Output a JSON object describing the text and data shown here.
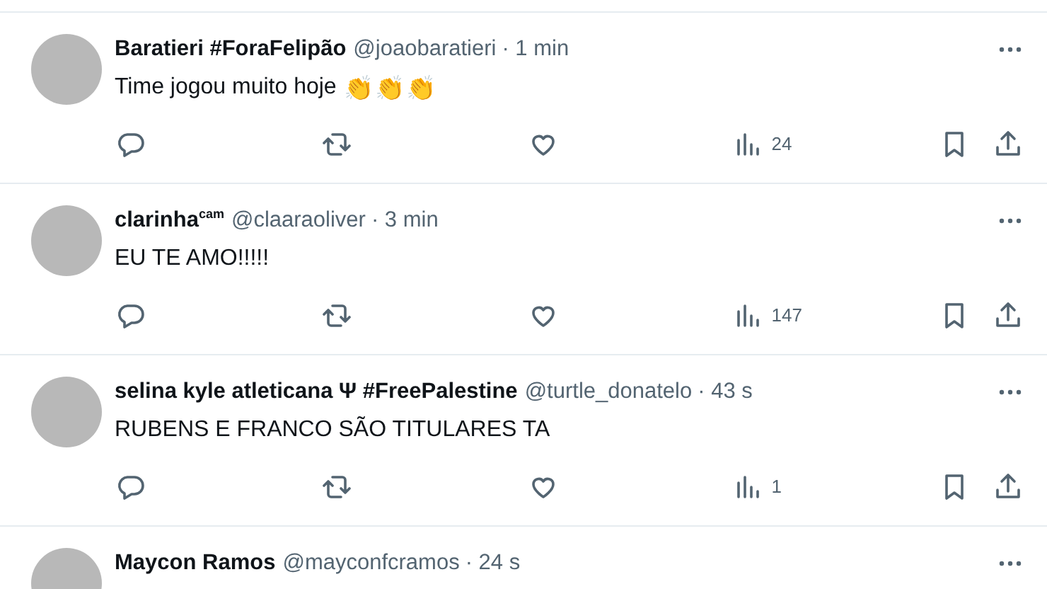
{
  "posts": [
    {
      "name": "Baratieri #ForaFelipão",
      "handle": "@joaobaratieri",
      "time": "· 1 min",
      "text": "Time jogou muito hoje",
      "emoji": "👏👏👏",
      "views": "24"
    },
    {
      "name": "clarinha$^{cam}$",
      "handle": "@claaraoliver",
      "time": "· 3 min",
      "text": "EU TE AMO!!!!!",
      "views": "147"
    },
    {
      "name": "selina kyle atleticana Ψ #FreePalestine",
      "handle": "@turtle_donatelo",
      "time": "· 43 s",
      "text": "RUBENS E FRANCO SÃO TITULARES TA",
      "views": "1"
    },
    {
      "name": "Maycon Ramos",
      "handle": "@mayconfcramos",
      "time": "· 24 s"
    }
  ]
}
